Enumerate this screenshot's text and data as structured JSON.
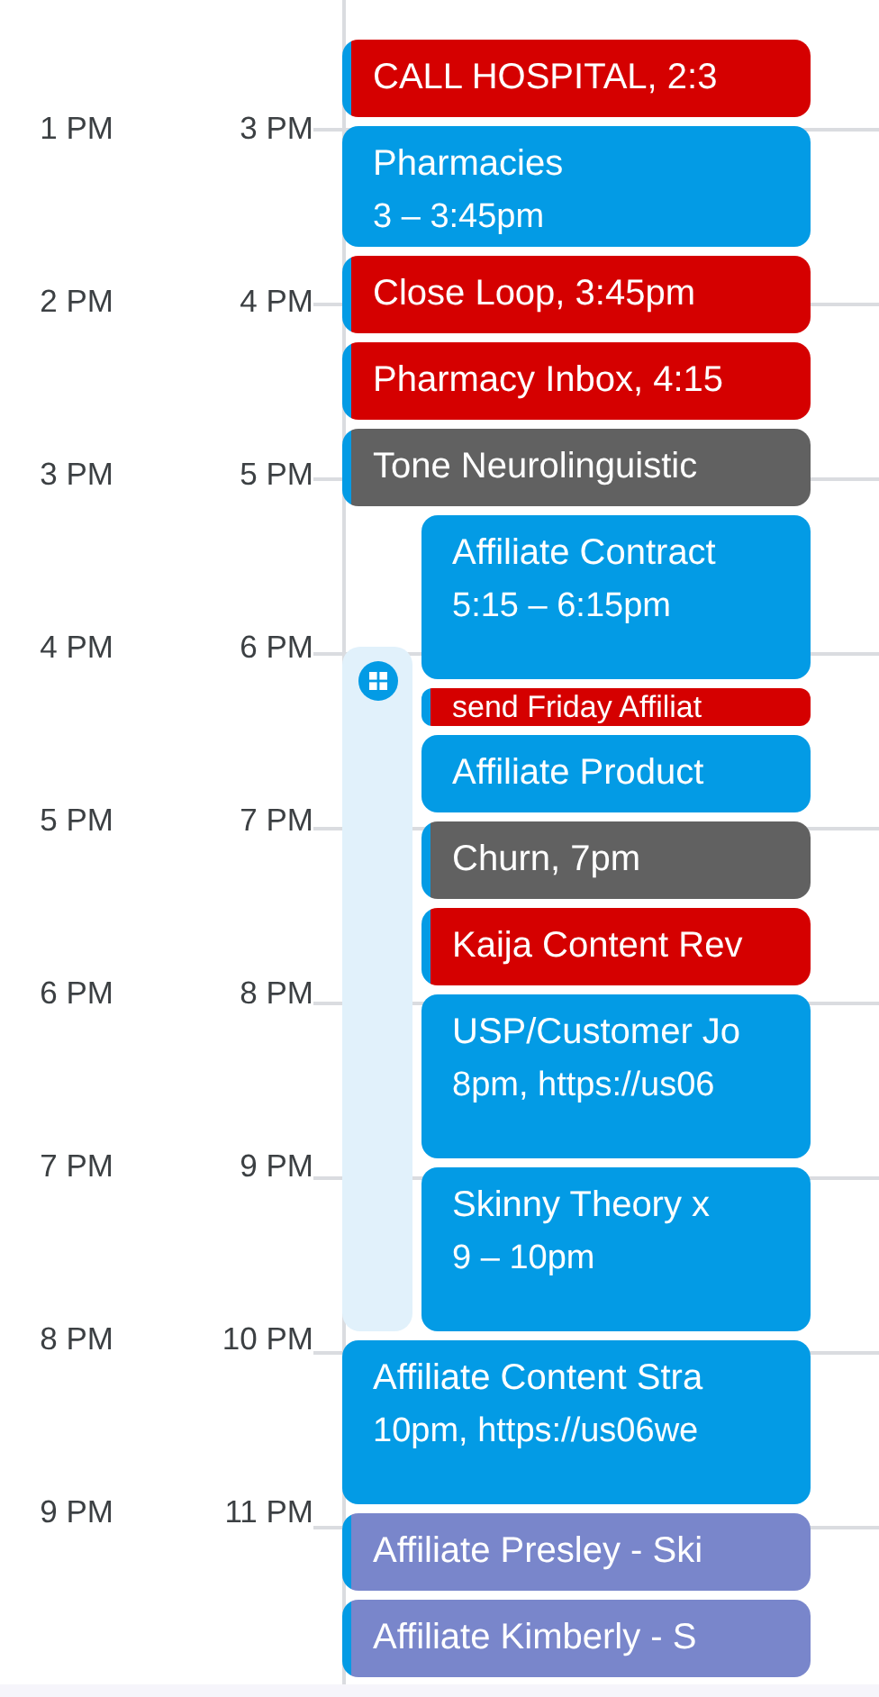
{
  "hours": [
    {
      "local": "1 PM",
      "other": "3 PM"
    },
    {
      "local": "2 PM",
      "other": "4 PM"
    },
    {
      "local": "3 PM",
      "other": "5 PM"
    },
    {
      "local": "4 PM",
      "other": "6 PM"
    },
    {
      "local": "5 PM",
      "other": "7 PM"
    },
    {
      "local": "6 PM",
      "other": "8 PM"
    },
    {
      "local": "7 PM",
      "other": "9 PM"
    },
    {
      "local": "8 PM",
      "other": "10 PM"
    },
    {
      "local": "9 PM",
      "other": "11 PM"
    }
  ],
  "events": [
    {
      "kind": "half",
      "title": "CALL HOSPITAL, 2:3",
      "color": "#d50000"
    },
    {
      "kind": "threequarter",
      "title": "Pharmacies",
      "time": "3 – 3:45pm",
      "color": "#039be5"
    },
    {
      "kind": "half",
      "title": "Close Loop, 3:45pm",
      "color": "#d50000"
    },
    {
      "kind": "half",
      "title": "Pharmacy Inbox, 4:15",
      "color": "#d50000"
    },
    {
      "kind": "half",
      "title": "Tone Neurolinguistic",
      "color": "#616161"
    },
    {
      "kind": "group",
      "children": [
        {
          "kind": "hour",
          "title": "Affiliate Contract",
          "time": "5:15 – 6:15pm",
          "color": "#039be5"
        },
        {
          "kind": "quarter",
          "title": "send Friday Affiliat",
          "color": "#d50000"
        },
        {
          "kind": "half",
          "title": "Affiliate Product",
          "color": "#039be5"
        },
        {
          "kind": "half",
          "title": "Churn, 7pm",
          "color": "#616161"
        },
        {
          "kind": "half",
          "title": "Kaija Content Rev",
          "color": "#d50000"
        },
        {
          "kind": "hour",
          "title": "USP/Customer Jo",
          "time": "8pm, https://us06",
          "color": "#039be5"
        },
        {
          "kind": "hour",
          "title": "Skinny Theory x",
          "time": "9 – 10pm",
          "color": "#039be5"
        }
      ]
    },
    {
      "kind": "hour",
      "title": "Affiliate Content Stra",
      "time": "10pm, https://us06we",
      "color": "#039be5"
    },
    {
      "kind": "half",
      "title": "Affiliate Presley - Ski",
      "color": "#7986cb"
    },
    {
      "kind": "half",
      "title": "Affiliate Kimberly - S",
      "color": "#7986cb"
    }
  ]
}
